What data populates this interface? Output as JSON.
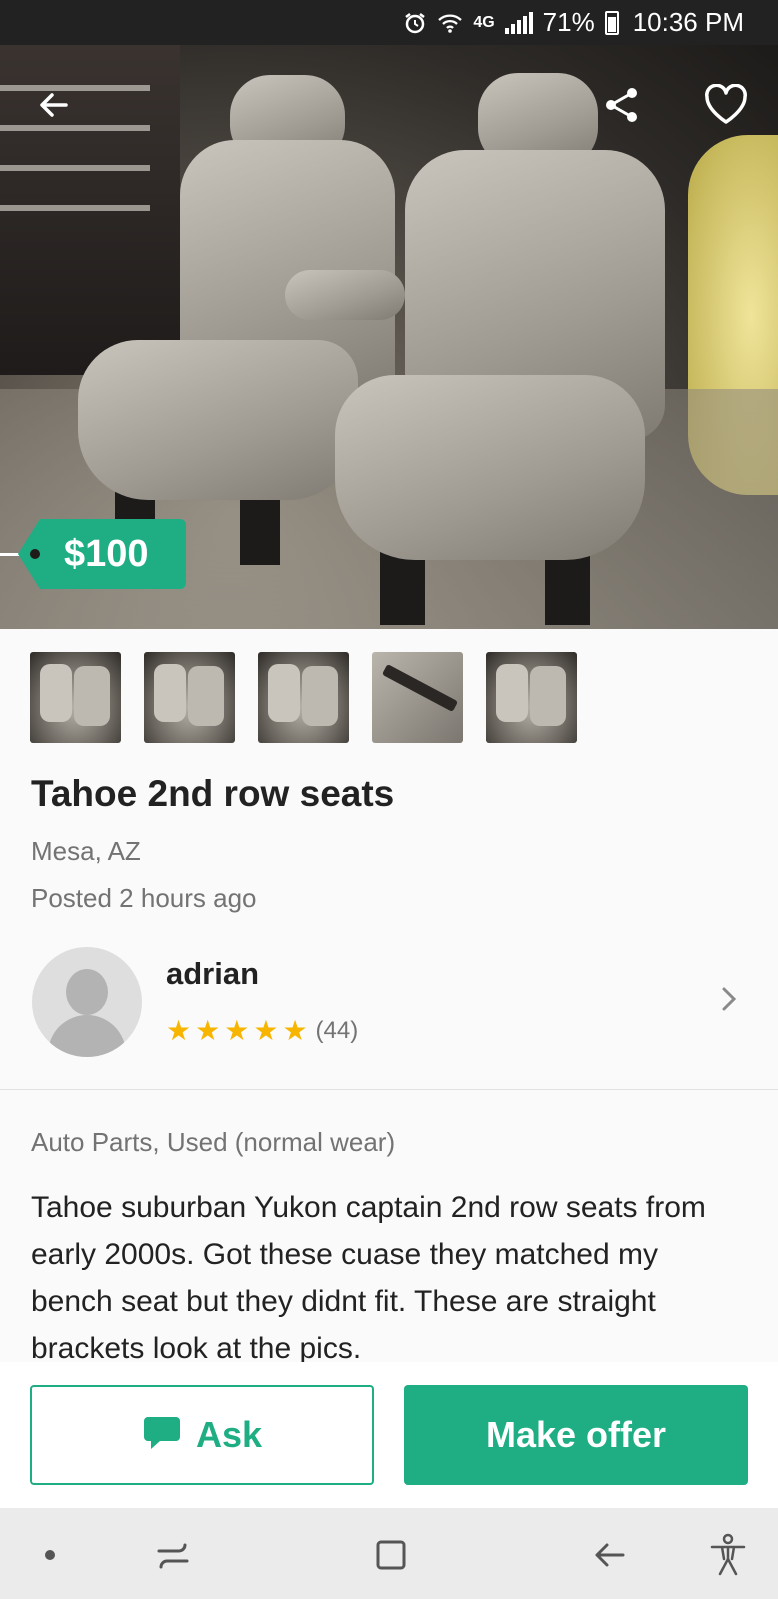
{
  "status_bar": {
    "network": "4G",
    "battery": "71%",
    "time": "10:36 PM",
    "icons": [
      "alarm-icon",
      "wifi-icon",
      "signal-icon",
      "battery-icon"
    ]
  },
  "hero": {
    "price": "$100",
    "icons": [
      "back-arrow-icon",
      "share-icon",
      "heart-icon"
    ],
    "thumbnail_count": 5
  },
  "listing": {
    "title": "Tahoe 2nd row seats",
    "location": "Mesa, AZ",
    "posted": "Posted 2 hours ago",
    "category": "Auto Parts, Used (normal wear)",
    "description": "Tahoe suburban Yukon captain 2nd row seats from early 2000s. Got these cuase they matched my bench seat but they didnt fit. These are straight brackets look at the pics."
  },
  "seller": {
    "name": "adrian",
    "rating": 5,
    "rating_count": "(44)"
  },
  "actions": {
    "ask_label": "Ask",
    "offer_label": "Make offer"
  },
  "colors": {
    "accent": "#1fae84",
    "star": "#f7b500",
    "status_bar": "#222222"
  }
}
